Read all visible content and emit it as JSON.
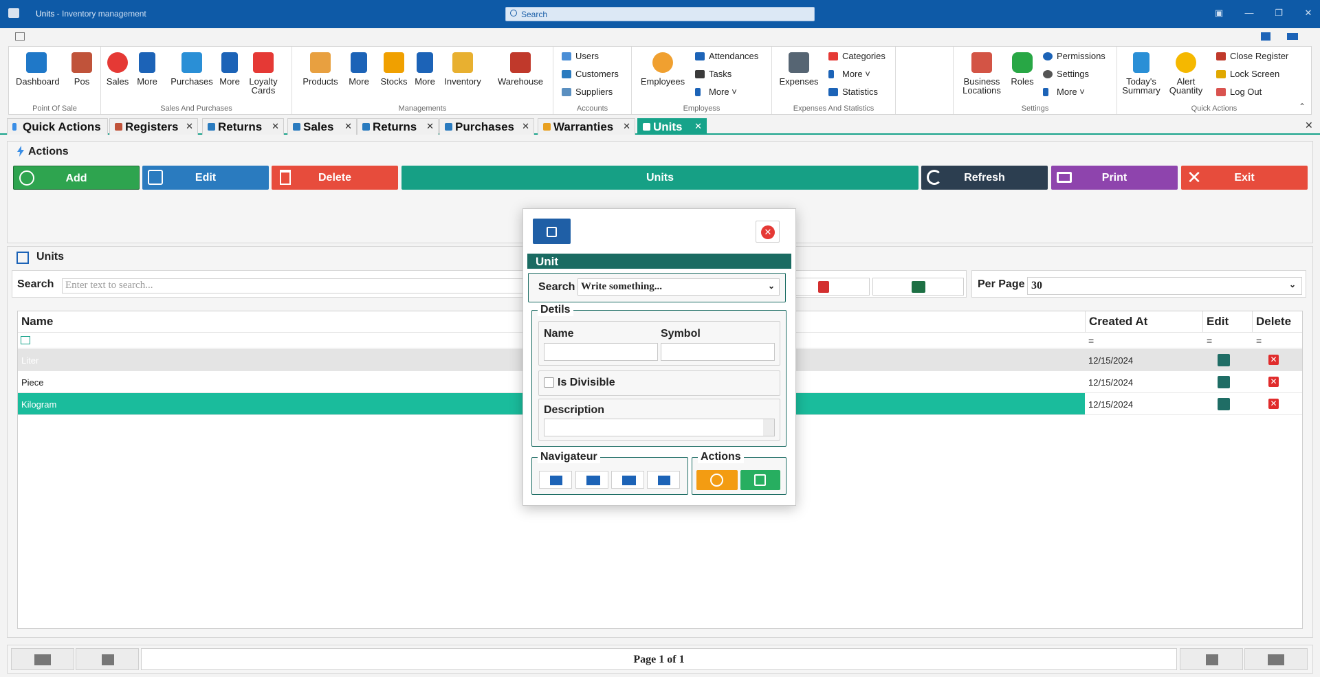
{
  "window": {
    "title": "Units",
    "subtitle": " - Inventory management",
    "search_placeholder": "Search"
  },
  "ribbon": {
    "groups": [
      {
        "label": "Point Of Sale",
        "buttons": [
          "Dashboard",
          "Pos"
        ]
      },
      {
        "label": "Sales And Purchases",
        "buttons": [
          "Sales",
          "More",
          "Purchases",
          "More",
          "Loyalty Cards"
        ]
      },
      {
        "label": "Managements",
        "buttons": [
          "Products",
          "More",
          "Stocks",
          "More",
          "Inventory",
          "Warehouse"
        ]
      },
      {
        "label": "Accounts",
        "buttons": [
          "Users",
          "Customers",
          "Suppliers"
        ]
      },
      {
        "label": "Employess",
        "buttons": [
          "Employees",
          "Attendances",
          "Tasks",
          "More"
        ]
      },
      {
        "label": "Expenses And Statistics",
        "buttons": [
          "Expenses",
          "Categories",
          "More",
          "Statistics"
        ]
      },
      {
        "label": "Settings",
        "buttons": [
          "Business Locations",
          "Roles",
          "Permissions",
          "Settings",
          "More"
        ]
      },
      {
        "label": "Quick Actions",
        "buttons": [
          "Today's Summary",
          "Alert Quantity",
          "Close Register",
          "Lock Screen",
          "Log Out"
        ]
      }
    ],
    "labels": {
      "dashboard": "Dashboard",
      "pos": "Pos",
      "sales": "Sales",
      "more": "More",
      "purchases": "Purchases",
      "loyalty": "Loyalty Cards",
      "products": "Products",
      "stocks": "Stocks",
      "inventory": "Inventory",
      "warehouse": "Warehouse",
      "users": "Users",
      "customers": "Customers",
      "suppliers": "Suppliers",
      "employees": "Employees",
      "attendances": "Attendances",
      "tasks": "Tasks",
      "expenses": "Expenses",
      "categories": "Categories",
      "statistics": "Statistics",
      "business": "Business Locations",
      "roles": "Roles",
      "permissions": "Permissions",
      "settings": "Settings",
      "summary": "Today's Summary",
      "alert": "Alert Quantity",
      "close_register": "Close Register",
      "lock_screen": "Lock Screen",
      "logout": "Log Out",
      "more_dd": "More"
    },
    "group_labels": {
      "pos": "Point Of Sale",
      "sp": "Sales And Purchases",
      "mg": "Managements",
      "acc": "Accounts",
      "emp": "Employess",
      "exp": "Expenses And Statistics",
      "set": "Settings",
      "qa": "Quick Actions"
    }
  },
  "tabs": [
    {
      "label": "Quick Actions",
      "closable": false
    },
    {
      "label": "Registers",
      "closable": true
    },
    {
      "label": "Returns",
      "closable": true
    },
    {
      "label": "Sales",
      "closable": true
    },
    {
      "label": "Returns",
      "closable": true
    },
    {
      "label": "Purchases",
      "closable": true
    },
    {
      "label": "Warranties",
      "closable": true
    },
    {
      "label": "Units",
      "closable": true,
      "active": true
    }
  ],
  "actions": {
    "title": "Actions",
    "add": "Add",
    "edit": "Edit",
    "delete": "Delete",
    "units": "Units",
    "refresh": "Refresh",
    "print": "Print",
    "exit": "Exit"
  },
  "units_panel": {
    "title": "Units",
    "search_label": "Search",
    "search_placeholder": "Enter text to search...",
    "per_page_label": "Per Page",
    "per_page_value": "30"
  },
  "grid": {
    "columns": {
      "name": "Name",
      "created_at": "Created At",
      "edit": "Edit",
      "delete": "Delete"
    },
    "filter_eq": "=",
    "rows": [
      {
        "name": "Liter",
        "created_at": "12/15/2024"
      },
      {
        "name": "Piece",
        "created_at": "12/15/2024"
      },
      {
        "name": "Kilogram",
        "created_at": "12/15/2024"
      }
    ]
  },
  "pager": {
    "text": "Page 1 of 1"
  },
  "modal": {
    "header": "Unit",
    "search_label": "Search",
    "search_value": "Write something...",
    "details_legend": "Detils",
    "name_label": "Name",
    "symbol_label": "Symbol",
    "divisible_label": "Is Divisible",
    "description_label": "Description",
    "navigator_legend": "Navigateur",
    "actions_legend": "Actions"
  },
  "colors": {
    "titlebar": "#0e5aa7",
    "accent": "#17a38a",
    "add": "#2ea44f",
    "edit": "#2a7bbf",
    "delete": "#e74c3c",
    "units": "#16a085",
    "refresh": "#2c3e50",
    "print": "#8e44ad",
    "exit": "#e74c3c"
  }
}
